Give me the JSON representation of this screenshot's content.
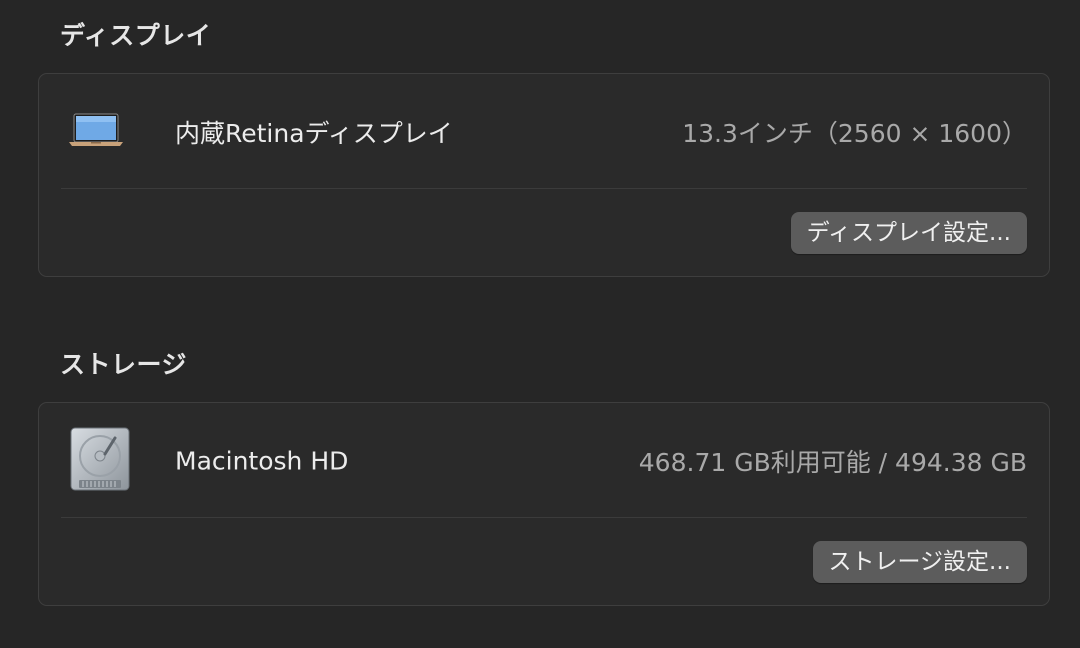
{
  "display": {
    "section_title": "ディスプレイ",
    "item": {
      "name": "内蔵Retinaディスプレイ",
      "value": "13.3インチ（2560 × 1600）",
      "icon": "laptop-icon"
    },
    "settings_button": "ディスプレイ設定..."
  },
  "storage": {
    "section_title": "ストレージ",
    "item": {
      "name": "Macintosh HD",
      "value": "468.71 GB利用可能 / 494.38 GB",
      "icon": "hard-drive-icon"
    },
    "settings_button": "ストレージ設定..."
  },
  "colors": {
    "background": "#262626",
    "panel": "#2a2a2a",
    "button": "#5c5c5c",
    "secondary_text": "#a9a9a9"
  }
}
